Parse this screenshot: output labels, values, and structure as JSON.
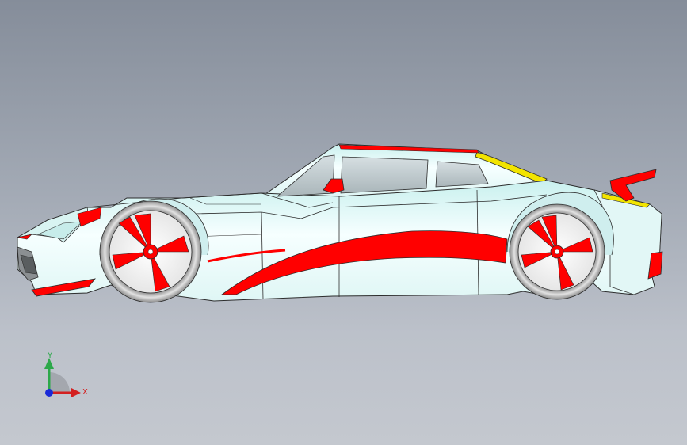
{
  "viewport": {
    "background_top": "#858d9a",
    "background_bottom": "#c4c8cf"
  },
  "model": {
    "body_color": "#eefafa",
    "accent_color": "#ff0000",
    "stripe_color": "#f2e400",
    "tire_color": "#c9c9c9",
    "glass_color": "#c2cfd3",
    "edge_color": "#2c2c2c"
  },
  "triad": {
    "y_label": "Y",
    "x_label": "X",
    "y_color": "#2ca84a",
    "x_color": "#d32020",
    "z_color": "#1a2ad8"
  }
}
